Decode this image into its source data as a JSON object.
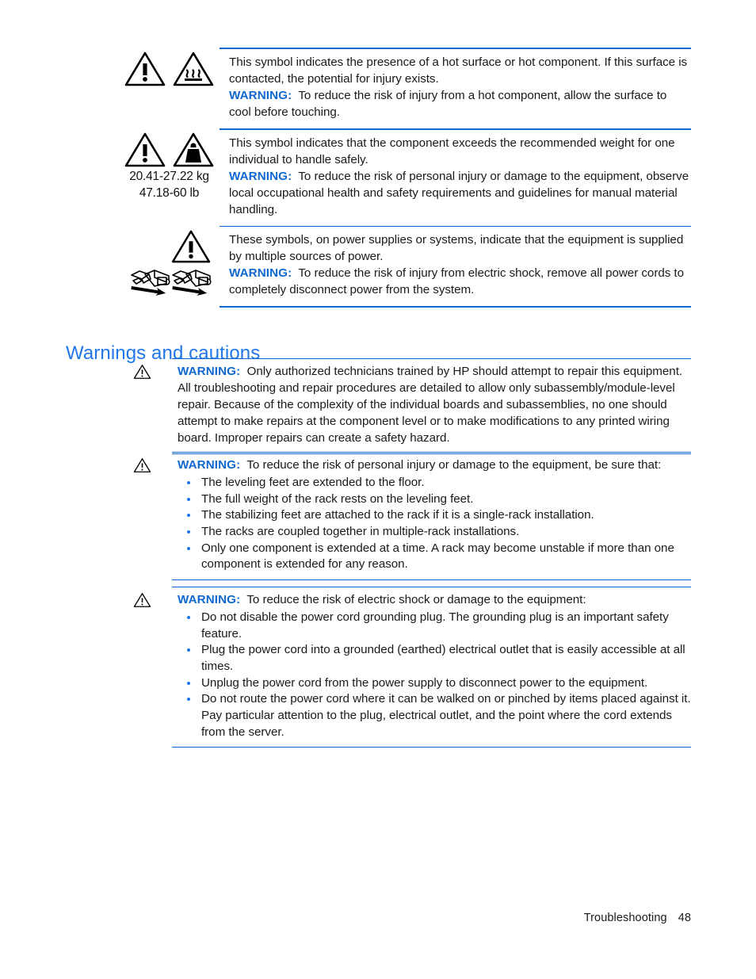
{
  "document": {
    "heading": "Warnings and cautions",
    "footer": {
      "section": "Troubleshooting",
      "page_number": "48"
    },
    "accent_color": "#2176e8",
    "rule_color": "#1068d0"
  },
  "symbol_table": {
    "rows": [
      {
        "icons": [
          "warning-triangle-icon",
          "hot-surface-icon"
        ],
        "caption": "",
        "caption_line2": "",
        "text_intro": "This symbol indicates the presence of a hot surface or hot component. If this surface is contacted, the potential for injury exists.",
        "warning_label": "WARNING:",
        "warning_text": "To reduce the risk of injury from a hot component, allow the surface to cool before touching."
      },
      {
        "icons": [
          "warning-triangle-icon",
          "heavy-weight-icon"
        ],
        "caption": "20.41-27.22 kg",
        "caption_line2": "47.18-60 lb",
        "text_intro": "This symbol indicates that the component exceeds the recommended weight for one individual to handle safely.",
        "warning_label": "WARNING:",
        "warning_text": "To reduce the risk of personal injury or damage to the equipment, observe local occupational health and safety requirements and guidelines for manual material handling."
      },
      {
        "icons": [
          "warning-triangle-icon",
          "multiple-power-supplies-icon"
        ],
        "caption": "",
        "caption_line2": "",
        "text_intro": "These symbols, on power supplies or systems, indicate that the equipment is supplied by multiple sources of power.",
        "warning_label": "WARNING:",
        "warning_text": "To reduce the risk of injury from electric shock, remove all power cords to completely disconnect power from the system."
      }
    ]
  },
  "warnings": [
    {
      "icon": "warning-triangle-icon",
      "label": "WARNING:",
      "text": "Only authorized technicians trained by HP should attempt to repair this equipment. All troubleshooting and repair procedures are detailed to allow only subassembly/module-level repair. Because of the complexity of the individual boards and subassemblies, no one should attempt to make repairs at the component level or to make modifications to any printed wiring board. Improper repairs can create a safety hazard.",
      "bullets": []
    },
    {
      "icon": "warning-triangle-icon",
      "label": "WARNING:",
      "text": "To reduce the risk of personal injury or damage to the equipment, be sure that:",
      "bullets": [
        "The leveling feet are extended to the floor.",
        "The full weight of the rack rests on the leveling feet.",
        "The stabilizing feet are attached to the rack if it is a single-rack installation.",
        "The racks are coupled together in multiple-rack installations.",
        "Only one component is extended at a time. A rack may become unstable if more than one component is extended for any reason."
      ]
    },
    {
      "icon": "warning-triangle-icon",
      "label": "WARNING:",
      "text": "To reduce the risk of electric shock or damage to the equipment:",
      "bullets": [
        "Do not disable the power cord grounding plug. The grounding plug is an important safety feature.",
        "Plug the power cord into a grounded (earthed) electrical outlet that is easily accessible at all times.",
        "Unplug the power cord from the power supply to disconnect power to the equipment.",
        "Do not route the power cord where it can be walked on or pinched by items placed against it. Pay particular attention to the plug, electrical outlet, and the point where the cord extends from the server."
      ]
    }
  ]
}
